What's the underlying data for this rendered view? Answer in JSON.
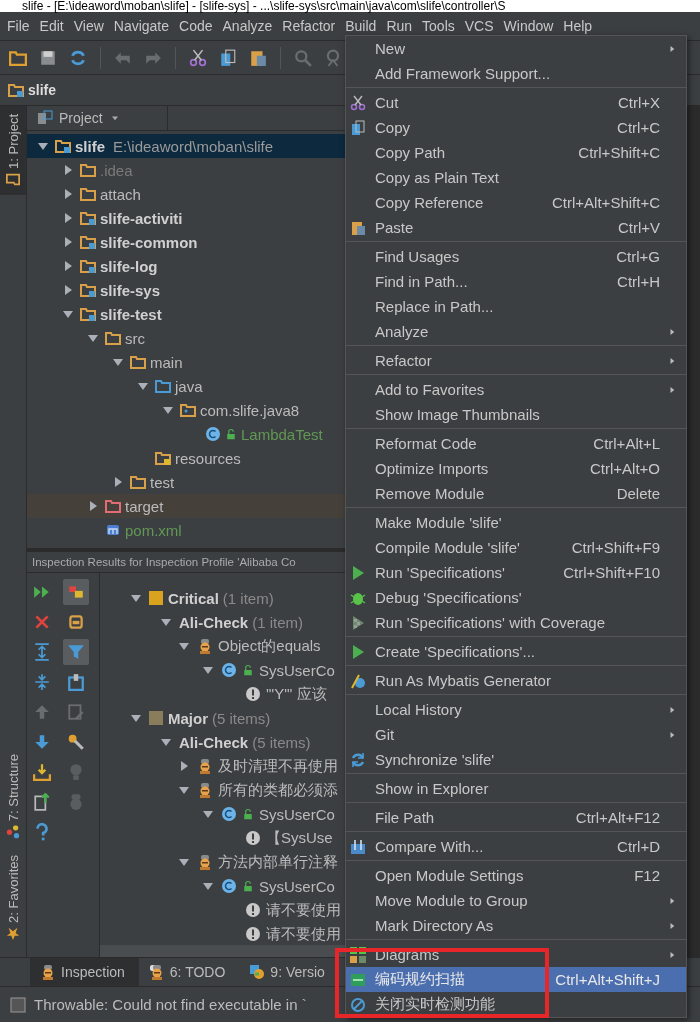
{
  "window": {
    "title": "slife - [E:\\ideaword\\moban\\slife] - [slife-sys] - ...\\slife-sys\\src\\main\\java\\com\\slife\\controller\\S"
  },
  "menu_bar": [
    "File",
    "Edit",
    "View",
    "Navigate",
    "Code",
    "Analyze",
    "Refactor",
    "Build",
    "Run",
    "Tools",
    "VCS",
    "Window",
    "Help"
  ],
  "nav_bar": {
    "crumb": "slife"
  },
  "side_tabs": [
    {
      "label": "1: Project",
      "selected": true
    },
    {
      "label": "7: Structure",
      "selected": false
    },
    {
      "label": "2: Favorites",
      "selected": false
    }
  ],
  "project": {
    "header": "Project",
    "tree": [
      {
        "name": "slife",
        "path": "E:\\ideaword\\moban\\slife",
        "kind": "root-module",
        "expanded": true,
        "selected": true,
        "children": [
          {
            "name": ".idea",
            "kind": "ignored",
            "expanded": false,
            "selected": false
          },
          {
            "name": "attach",
            "kind": "folder",
            "expanded": false,
            "selected": false
          },
          {
            "name": "slife-activiti",
            "kind": "module",
            "expanded": false,
            "selected": false
          },
          {
            "name": "slife-common",
            "kind": "module",
            "expanded": false,
            "selected": false
          },
          {
            "name": "slife-log",
            "kind": "module",
            "expanded": false,
            "selected": false
          },
          {
            "name": "slife-sys",
            "kind": "module",
            "expanded": false,
            "selected": false
          },
          {
            "name": "slife-test",
            "kind": "module",
            "expanded": true,
            "selected": false,
            "children": [
              {
                "name": "src",
                "kind": "folder",
                "expanded": true,
                "selected": false,
                "children": [
                  {
                    "name": "main",
                    "kind": "folder",
                    "expanded": true,
                    "selected": false,
                    "children": [
                      {
                        "name": "java",
                        "kind": "source-folder",
                        "expanded": true,
                        "selected": false,
                        "children": [
                          {
                            "name": "com.slife.java8",
                            "kind": "package",
                            "expanded": true,
                            "selected": false,
                            "children": [
                              {
                                "name": "LambdaTest",
                                "kind": "class",
                                "selected": false
                              }
                            ]
                          }
                        ]
                      },
                      {
                        "name": "resources",
                        "kind": "resources",
                        "selected": false
                      }
                    ]
                  },
                  {
                    "name": "test",
                    "kind": "folder",
                    "expanded": false,
                    "selected": false
                  }
                ]
              },
              {
                "name": "target",
                "kind": "excluded",
                "expanded": false,
                "selected": false
              },
              {
                "name": "pom.xml",
                "kind": "maven-file",
                "selected": false
              }
            ]
          }
        ]
      }
    ]
  },
  "inspection": {
    "header": "Inspection Results for Inspection Profile 'Alibaba Co",
    "toggles": [
      {
        "pressed": true
      },
      {
        "pressed": false
      },
      {
        "pressed": true
      },
      {
        "pressed": false
      },
      {
        "pressed": false
      },
      {
        "pressed": false
      },
      {
        "pressed": false
      },
      {
        "pressed": false
      }
    ],
    "tree": [
      {
        "kind": "severity",
        "label": "Critical",
        "count": "(1 item)",
        "color": "#d9a31f",
        "expanded": true,
        "children": [
          {
            "kind": "group",
            "label": "Ali-Check",
            "count": "(1 item)",
            "expanded": true,
            "children": [
              {
                "kind": "rule",
                "label": "Object的equals",
                "expanded": true,
                "children": [
                  {
                    "kind": "class",
                    "label": "SysUserCo",
                    "expanded": true,
                    "children": [
                      {
                        "kind": "problem",
                        "label": "'\"Y\"' 应该"
                      }
                    ]
                  }
                ]
              }
            ]
          }
        ]
      },
      {
        "kind": "severity",
        "label": "Major",
        "count": "(5 items)",
        "color": "#8a7d5c",
        "expanded": true,
        "children": [
          {
            "kind": "group",
            "label": "Ali-Check",
            "count": "(5 items)",
            "expanded": true,
            "children": [
              {
                "kind": "rule",
                "label": "及时清理不再使用",
                "expanded": false
              },
              {
                "kind": "rule",
                "label": "所有的类都必须添",
                "expanded": true,
                "children": [
                  {
                    "kind": "class",
                    "label": "SysUserCo",
                    "expanded": true,
                    "children": [
                      {
                        "kind": "problem",
                        "label": "【SysUse"
                      }
                    ]
                  }
                ]
              },
              {
                "kind": "rule",
                "label": "方法内部单行注释",
                "expanded": true,
                "children": [
                  {
                    "kind": "class",
                    "label": "SysUserCo",
                    "expanded": true,
                    "children": [
                      {
                        "kind": "problem",
                        "label": "请不要使用"
                      },
                      {
                        "kind": "problem",
                        "label": "请不要使用"
                      }
                    ]
                  }
                ]
              }
            ]
          }
        ]
      }
    ]
  },
  "bottom_tabs": [
    {
      "label": "Inspection",
      "selected": true
    },
    {
      "label": "6: TODO",
      "selected": false
    },
    {
      "label": "9: Versio",
      "selected": false
    }
  ],
  "status_bar": {
    "message": "Throwable: Could not find executable in `"
  },
  "context_menu": {
    "sections": [
      [
        {
          "label": "New",
          "submenu": true,
          "selected": false
        },
        {
          "label": "Add Framework Support...",
          "submenu": false,
          "selected": false
        }
      ],
      [
        {
          "label": "Cut",
          "shortcut": "Ctrl+X",
          "submenu": false,
          "selected": false
        },
        {
          "label": "Copy",
          "shortcut": "Ctrl+C",
          "submenu": false,
          "selected": false
        },
        {
          "label": "Copy Path",
          "shortcut": "Ctrl+Shift+C",
          "submenu": false,
          "selected": false
        },
        {
          "label": "Copy as Plain Text",
          "submenu": false,
          "selected": false
        },
        {
          "label": "Copy Reference",
          "shortcut": "Ctrl+Alt+Shift+C",
          "submenu": false,
          "selected": false
        },
        {
          "label": "Paste",
          "shortcut": "Ctrl+V",
          "submenu": false,
          "selected": false
        }
      ],
      [
        {
          "label": "Find Usages",
          "shortcut": "Ctrl+G",
          "submenu": false,
          "selected": false
        },
        {
          "label": "Find in Path...",
          "shortcut": "Ctrl+H",
          "submenu": false,
          "selected": false
        },
        {
          "label": "Replace in Path...",
          "submenu": false,
          "selected": false
        },
        {
          "label": "Analyze",
          "submenu": true,
          "selected": false
        }
      ],
      [
        {
          "label": "Refactor",
          "submenu": true,
          "selected": false
        }
      ],
      [
        {
          "label": "Add to Favorites",
          "submenu": true,
          "selected": false
        },
        {
          "label": "Show Image Thumbnails",
          "submenu": false,
          "selected": false
        }
      ],
      [
        {
          "label": "Reformat Code",
          "shortcut": "Ctrl+Alt+L",
          "submenu": false,
          "selected": false
        },
        {
          "label": "Optimize Imports",
          "shortcut": "Ctrl+Alt+O",
          "submenu": false,
          "selected": false
        },
        {
          "label": "Remove Module",
          "shortcut": "Delete",
          "submenu": false,
          "selected": false
        }
      ],
      [
        {
          "label": "Make Module 'slife'",
          "submenu": false,
          "selected": false
        },
        {
          "label": "Compile Module 'slife'",
          "shortcut": "Ctrl+Shift+F9",
          "submenu": false,
          "selected": false
        },
        {
          "label": "Run 'Specifications'",
          "shortcut": "Ctrl+Shift+F10",
          "submenu": false,
          "selected": false
        },
        {
          "label": "Debug 'Specifications'",
          "submenu": false,
          "selected": false
        },
        {
          "label": "Run 'Specifications' with Coverage",
          "submenu": false,
          "selected": false
        }
      ],
      [
        {
          "label": "Create 'Specifications'...",
          "submenu": false,
          "selected": false
        }
      ],
      [
        {
          "label": "Run As Mybatis Generator",
          "submenu": false,
          "selected": false
        }
      ],
      [
        {
          "label": "Local History",
          "submenu": true,
          "selected": false
        },
        {
          "label": "Git",
          "submenu": true,
          "selected": false
        },
        {
          "label": "Synchronize 'slife'",
          "submenu": false,
          "selected": false
        }
      ],
      [
        {
          "label": "Show in Explorer",
          "submenu": false,
          "selected": false
        }
      ],
      [
        {
          "label": "File Path",
          "shortcut": "Ctrl+Alt+F12",
          "submenu": false,
          "selected": false
        }
      ],
      [
        {
          "label": "Compare With...",
          "shortcut": "Ctrl+D",
          "submenu": false,
          "selected": false
        }
      ],
      [
        {
          "label": "Open Module Settings",
          "shortcut": "F12",
          "submenu": false,
          "selected": false
        },
        {
          "label": "Move Module to Group",
          "submenu": true,
          "selected": false
        },
        {
          "label": "Mark Directory As",
          "submenu": true,
          "selected": false
        }
      ],
      [
        {
          "label": "Diagrams",
          "submenu": true,
          "selected": false
        },
        {
          "label": "编码规约扫描",
          "shortcut": "Ctrl+Alt+Shift+J",
          "submenu": false,
          "selected": true
        },
        {
          "label": "关闭实时检测功能",
          "submenu": false,
          "selected": false
        }
      ]
    ]
  }
}
